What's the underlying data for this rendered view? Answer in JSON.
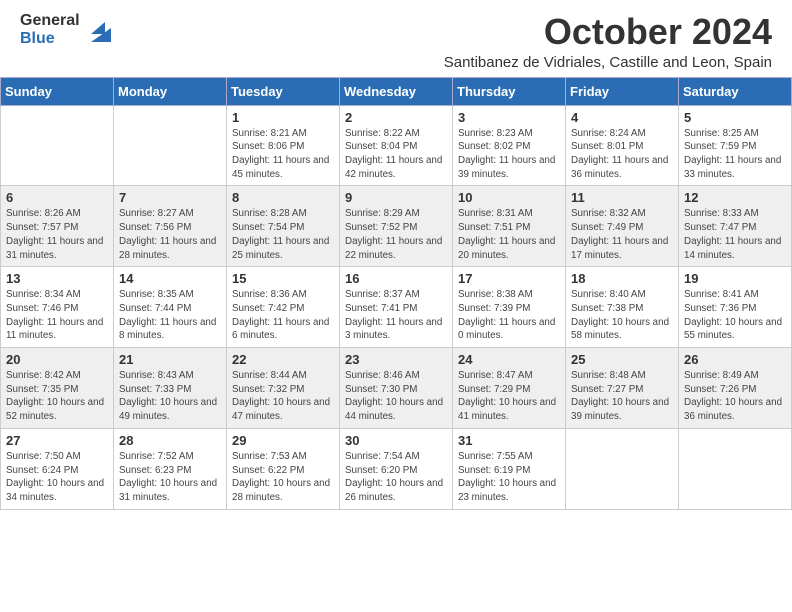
{
  "header": {
    "logo_line1": "General",
    "logo_line2": "Blue",
    "main_title": "October 2024",
    "subtitle": "Santibanez de Vidriales, Castille and Leon, Spain"
  },
  "days_of_week": [
    "Sunday",
    "Monday",
    "Tuesday",
    "Wednesday",
    "Thursday",
    "Friday",
    "Saturday"
  ],
  "weeks": [
    [
      {
        "day": "",
        "info": ""
      },
      {
        "day": "",
        "info": ""
      },
      {
        "day": "1",
        "info": "Sunrise: 8:21 AM\nSunset: 8:06 PM\nDaylight: 11 hours and 45 minutes."
      },
      {
        "day": "2",
        "info": "Sunrise: 8:22 AM\nSunset: 8:04 PM\nDaylight: 11 hours and 42 minutes."
      },
      {
        "day": "3",
        "info": "Sunrise: 8:23 AM\nSunset: 8:02 PM\nDaylight: 11 hours and 39 minutes."
      },
      {
        "day": "4",
        "info": "Sunrise: 8:24 AM\nSunset: 8:01 PM\nDaylight: 11 hours and 36 minutes."
      },
      {
        "day": "5",
        "info": "Sunrise: 8:25 AM\nSunset: 7:59 PM\nDaylight: 11 hours and 33 minutes."
      }
    ],
    [
      {
        "day": "6",
        "info": "Sunrise: 8:26 AM\nSunset: 7:57 PM\nDaylight: 11 hours and 31 minutes."
      },
      {
        "day": "7",
        "info": "Sunrise: 8:27 AM\nSunset: 7:56 PM\nDaylight: 11 hours and 28 minutes."
      },
      {
        "day": "8",
        "info": "Sunrise: 8:28 AM\nSunset: 7:54 PM\nDaylight: 11 hours and 25 minutes."
      },
      {
        "day": "9",
        "info": "Sunrise: 8:29 AM\nSunset: 7:52 PM\nDaylight: 11 hours and 22 minutes."
      },
      {
        "day": "10",
        "info": "Sunrise: 8:31 AM\nSunset: 7:51 PM\nDaylight: 11 hours and 20 minutes."
      },
      {
        "day": "11",
        "info": "Sunrise: 8:32 AM\nSunset: 7:49 PM\nDaylight: 11 hours and 17 minutes."
      },
      {
        "day": "12",
        "info": "Sunrise: 8:33 AM\nSunset: 7:47 PM\nDaylight: 11 hours and 14 minutes."
      }
    ],
    [
      {
        "day": "13",
        "info": "Sunrise: 8:34 AM\nSunset: 7:46 PM\nDaylight: 11 hours and 11 minutes."
      },
      {
        "day": "14",
        "info": "Sunrise: 8:35 AM\nSunset: 7:44 PM\nDaylight: 11 hours and 8 minutes."
      },
      {
        "day": "15",
        "info": "Sunrise: 8:36 AM\nSunset: 7:42 PM\nDaylight: 11 hours and 6 minutes."
      },
      {
        "day": "16",
        "info": "Sunrise: 8:37 AM\nSunset: 7:41 PM\nDaylight: 11 hours and 3 minutes."
      },
      {
        "day": "17",
        "info": "Sunrise: 8:38 AM\nSunset: 7:39 PM\nDaylight: 11 hours and 0 minutes."
      },
      {
        "day": "18",
        "info": "Sunrise: 8:40 AM\nSunset: 7:38 PM\nDaylight: 10 hours and 58 minutes."
      },
      {
        "day": "19",
        "info": "Sunrise: 8:41 AM\nSunset: 7:36 PM\nDaylight: 10 hours and 55 minutes."
      }
    ],
    [
      {
        "day": "20",
        "info": "Sunrise: 8:42 AM\nSunset: 7:35 PM\nDaylight: 10 hours and 52 minutes."
      },
      {
        "day": "21",
        "info": "Sunrise: 8:43 AM\nSunset: 7:33 PM\nDaylight: 10 hours and 49 minutes."
      },
      {
        "day": "22",
        "info": "Sunrise: 8:44 AM\nSunset: 7:32 PM\nDaylight: 10 hours and 47 minutes."
      },
      {
        "day": "23",
        "info": "Sunrise: 8:46 AM\nSunset: 7:30 PM\nDaylight: 10 hours and 44 minutes."
      },
      {
        "day": "24",
        "info": "Sunrise: 8:47 AM\nSunset: 7:29 PM\nDaylight: 10 hours and 41 minutes."
      },
      {
        "day": "25",
        "info": "Sunrise: 8:48 AM\nSunset: 7:27 PM\nDaylight: 10 hours and 39 minutes."
      },
      {
        "day": "26",
        "info": "Sunrise: 8:49 AM\nSunset: 7:26 PM\nDaylight: 10 hours and 36 minutes."
      }
    ],
    [
      {
        "day": "27",
        "info": "Sunrise: 7:50 AM\nSunset: 6:24 PM\nDaylight: 10 hours and 34 minutes."
      },
      {
        "day": "28",
        "info": "Sunrise: 7:52 AM\nSunset: 6:23 PM\nDaylight: 10 hours and 31 minutes."
      },
      {
        "day": "29",
        "info": "Sunrise: 7:53 AM\nSunset: 6:22 PM\nDaylight: 10 hours and 28 minutes."
      },
      {
        "day": "30",
        "info": "Sunrise: 7:54 AM\nSunset: 6:20 PM\nDaylight: 10 hours and 26 minutes."
      },
      {
        "day": "31",
        "info": "Sunrise: 7:55 AM\nSunset: 6:19 PM\nDaylight: 10 hours and 23 minutes."
      },
      {
        "day": "",
        "info": ""
      },
      {
        "day": "",
        "info": ""
      }
    ]
  ]
}
